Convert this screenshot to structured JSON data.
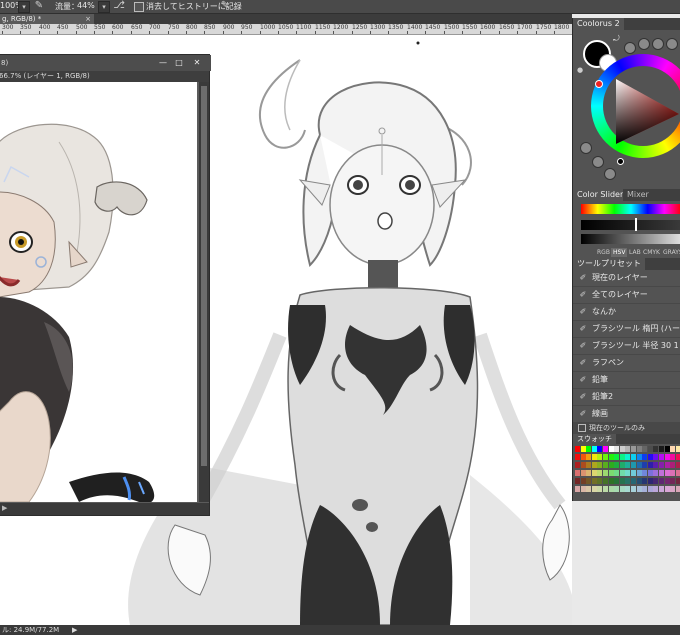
{
  "options_bar": {
    "zoom_value": "100%",
    "flow_label": "流量：",
    "flow_value": "44%",
    "erase_history_label": "消去してヒストリーに記録"
  },
  "document_tab": {
    "title": "g, RGB/8) *",
    "close": "×"
  },
  "ruler": {
    "ticks": [
      "300",
      "350",
      "400",
      "450",
      "500",
      "550",
      "600",
      "650",
      "700",
      "750",
      "800",
      "850",
      "900",
      "950",
      "1000",
      "1050",
      "1100",
      "1150",
      "1200",
      "1250",
      "1300",
      "1350",
      "1400",
      "1450",
      "1500",
      "1550",
      "1600",
      "1650",
      "1700",
      "1750",
      "1800"
    ]
  },
  "subwindow": {
    "title_fragment": "8)",
    "info": "66.7% (レイヤー 1, RGB/8)",
    "minimize": "—",
    "maximize": "□",
    "close": "✕",
    "play": "▶"
  },
  "status": {
    "doc_size": "ル: 24.9M/77.2M",
    "arrow": "▶"
  },
  "panels": {
    "coolorus_tab": "Coolorus 2",
    "color_sliders_tab": "Color Sliders",
    "mixer_tab": "Mixer",
    "modes": [
      "RGB",
      "HSV",
      "LAB",
      "CMYK",
      "GRAYS"
    ],
    "active_mode": "HSV",
    "tool_presets_title": "ツールプリセット",
    "presets": [
      "現在のレイヤー",
      "全てのレイヤー",
      "なんか",
      "ブラシツール 楕円 (ハード) 124 ピクセル",
      "ブラシツール 半径 30 1",
      "ラフペン",
      "鉛筆",
      "鉛筆2",
      "線画"
    ],
    "current_tool_only": "現在のツールのみ",
    "swatches_tab": "スウォッチ"
  },
  "colors": {
    "foreground": "#000000",
    "background": "#ffffff",
    "panel_bg": "#535353",
    "toolbar_bg": "#4a4a4a",
    "canvas_bg": "#ffffff"
  }
}
